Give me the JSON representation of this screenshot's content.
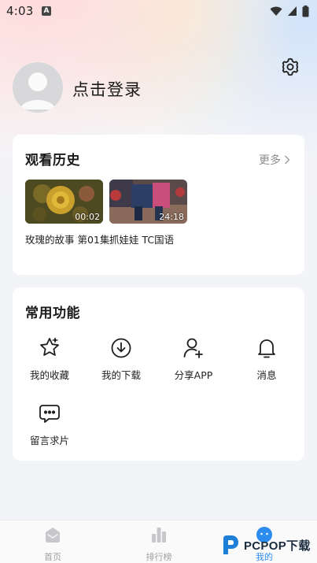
{
  "status_bar": {
    "time": "4:03",
    "notif_letter": "A"
  },
  "profile": {
    "login_label": "点击登录"
  },
  "history": {
    "title": "观看历史",
    "more_label": "更多",
    "videos": [
      {
        "title": "玫瑰的故事 第01集",
        "duration": "00:02"
      },
      {
        "title": "抓娃娃 TC国语",
        "duration": "24:18"
      }
    ]
  },
  "tools": {
    "title": "常用功能",
    "items": [
      {
        "label": "我的收藏",
        "icon": "star-icon"
      },
      {
        "label": "我的下载",
        "icon": "download-icon"
      },
      {
        "label": "分享APP",
        "icon": "share-user-icon"
      },
      {
        "label": "消息",
        "icon": "bell-icon"
      },
      {
        "label": "留言求片",
        "icon": "message-icon"
      }
    ]
  },
  "bottom_nav": {
    "items": [
      {
        "label": "首页",
        "icon": "home-icon"
      },
      {
        "label": "排行榜",
        "icon": "ranking-icon"
      },
      {
        "label": "我的",
        "icon": "profile-icon",
        "active": true
      }
    ]
  },
  "watermark": {
    "text": "PCPOP下载"
  },
  "colors": {
    "accent": "#2d8cf0",
    "card_bg": "#ffffff",
    "page_bg": "#f3f4f8"
  }
}
